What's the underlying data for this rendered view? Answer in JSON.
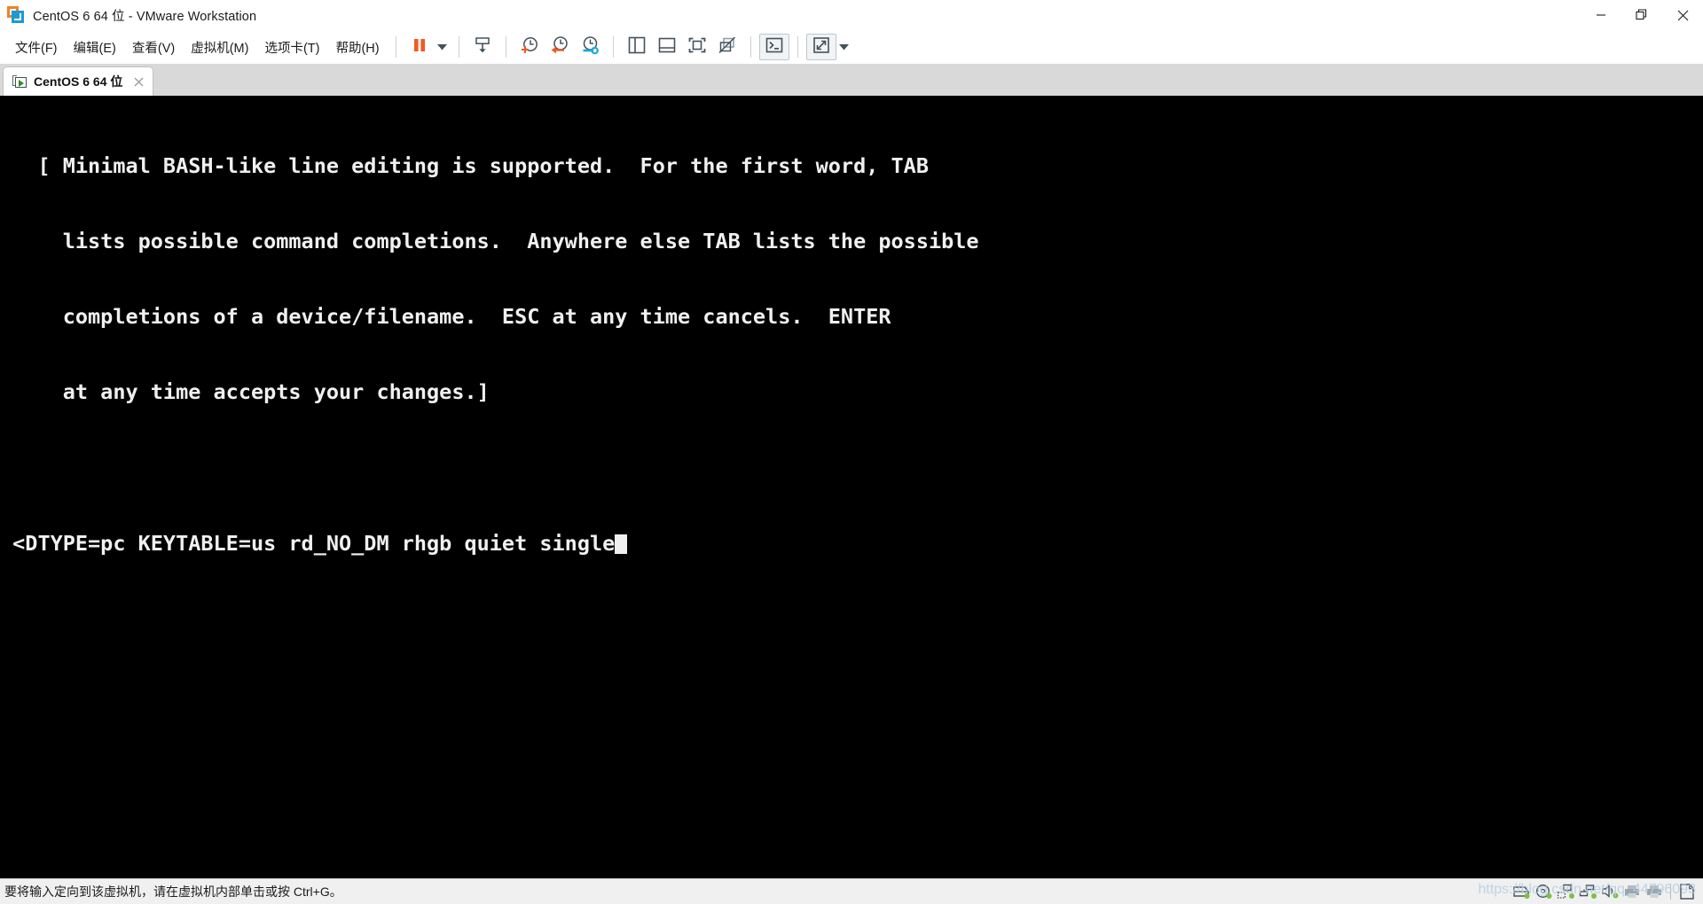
{
  "window": {
    "title": "CentOS 6 64 位 - VMware Workstation",
    "app_icon": "vmware-logo-icon",
    "controls": {
      "minimize": "minimize-icon",
      "restore": "restore-icon",
      "close": "close-icon"
    }
  },
  "menu": {
    "items": [
      {
        "label": "文件(F)",
        "name": "menu-file"
      },
      {
        "label": "编辑(E)",
        "name": "menu-edit"
      },
      {
        "label": "查看(V)",
        "name": "menu-view"
      },
      {
        "label": "虚拟机(M)",
        "name": "menu-vm"
      },
      {
        "label": "选项卡(T)",
        "name": "menu-tabs"
      },
      {
        "label": "帮助(H)",
        "name": "menu-help"
      }
    ]
  },
  "toolbar": {
    "buttons": [
      {
        "name": "suspend-button",
        "icon": "pause-icon",
        "tooltip": "挂起"
      },
      {
        "name": "power-dropdown-button",
        "icon": "chevron-down-icon",
        "tooltip": "电源"
      },
      {
        "name": "send-ctrl-alt-del-button",
        "icon": "send-keys-icon",
        "tooltip": "发送组合键"
      },
      {
        "name": "take-snapshot-button",
        "icon": "snapshot-add-icon",
        "tooltip": "拍摄此虚拟机的快照"
      },
      {
        "name": "revert-snapshot-button",
        "icon": "snapshot-revert-icon",
        "tooltip": "恢复到快照"
      },
      {
        "name": "manage-snapshots-button",
        "icon": "snapshot-manager-icon",
        "tooltip": "管理快照"
      },
      {
        "name": "show-library-button",
        "icon": "panel-left-icon",
        "tooltip": "显示或隐藏库"
      },
      {
        "name": "show-thumbnail-bar-button",
        "icon": "panel-bottom-icon",
        "tooltip": "显示或隐藏缩略图栏"
      },
      {
        "name": "fit-guest-button",
        "icon": "fit-guest-icon",
        "tooltip": "自动适应客户机"
      },
      {
        "name": "unity-mode-button",
        "icon": "unity-disabled-icon",
        "tooltip": "Unity 模式"
      },
      {
        "name": "console-view-button",
        "icon": "console-icon",
        "tooltip": "控制台视图",
        "active": true
      },
      {
        "name": "fullscreen-button",
        "icon": "fullscreen-icon",
        "tooltip": "进入全屏"
      },
      {
        "name": "fullscreen-dropdown-button",
        "icon": "chevron-down-icon",
        "tooltip": "全屏选项"
      }
    ]
  },
  "tabs": [
    {
      "label": "CentOS 6 64 位",
      "name": "tab-centos-6-64",
      "icon": "vm-running-icon",
      "close_icon": "close-icon",
      "active": true
    }
  ],
  "console": {
    "lines": [
      "   [ Minimal BASH-like line editing is supported.  For the first word, TAB",
      "     lists possible command completions.  Anywhere else TAB lists the possible",
      "     completions of a device/filename.  ESC at any time cancels.  ENTER",
      "     at any time accepts your changes.]",
      "",
      " <DTYPE=pc KEYTABLE=us rd_NO_DM rhgb quiet single"
    ],
    "cursor_line_index": 5,
    "cursor_visible": true,
    "background": "#000000",
    "foreground": "#f0f0f0"
  },
  "statusbar": {
    "message": "要将输入定向到该虚拟机，请在虚拟机内部单击或按 Ctrl+G。",
    "icons": [
      {
        "name": "status-hard-disk-icon",
        "label": "硬盘",
        "connected": true
      },
      {
        "name": "status-cd-dvd-icon",
        "label": "CD/DVD",
        "connected": true
      },
      {
        "name": "status-network-adapter-icon",
        "label": "网络适配器",
        "connected": true
      },
      {
        "name": "status-usb-controller-icon",
        "label": "USB 控制器",
        "connected": true
      },
      {
        "name": "status-sound-card-icon",
        "label": "声卡",
        "connected": true
      },
      {
        "name": "status-printer-icon",
        "label": "打印机",
        "connected": false
      },
      {
        "name": "status-printer2-icon",
        "label": "打印机",
        "connected": false
      },
      {
        "name": "status-message-log-icon",
        "label": "消息日志",
        "connected": false
      }
    ]
  },
  "watermark": {
    "text": "https://blog.csdn.net/qq_44796093"
  },
  "colors": {
    "accent_orange": "#f58220",
    "accent_blue": "#1b9ad6",
    "icon_slate": "#4a5b66",
    "status_green": "#7ac143",
    "console_bg": "#000000",
    "tabstrip_bg": "#d9d9d9",
    "statusbar_bg": "#f0f0f0"
  }
}
